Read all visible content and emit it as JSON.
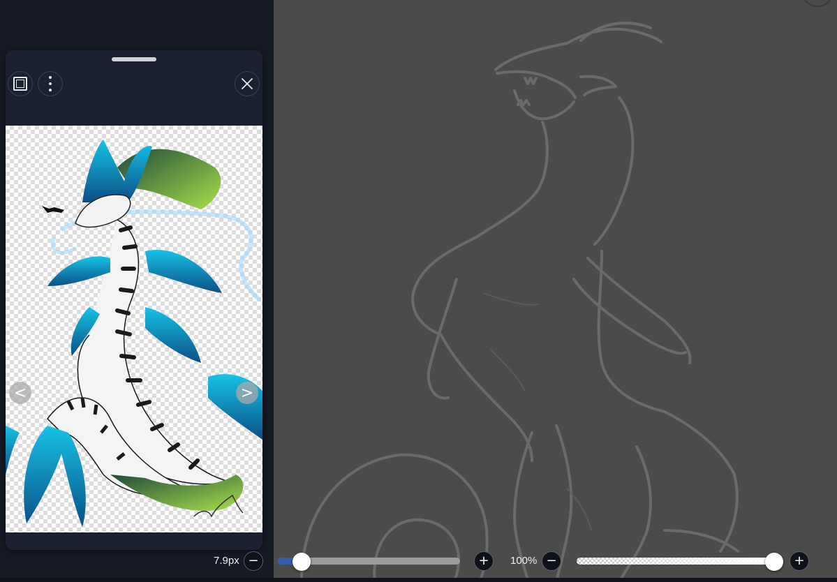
{
  "canvas": {
    "background": "#4b4b4b",
    "sketch_stroke": "#6e6e6e"
  },
  "reference_panel": {
    "frame_icon": "frame-icon",
    "more_icon": "more-vertical-icon",
    "close_icon": "close-icon",
    "prev_icon": "chevron-left-icon",
    "next_icon": "chevron-right-icon",
    "prev_glyph": "<",
    "next_glyph": ">",
    "image_description_colors": [
      "#0b7fb0",
      "#17c3e6",
      "#1f4b3b",
      "#a7e04a",
      "#1a1a1a"
    ]
  },
  "toolbar": {
    "brush_size_label": "7.9px",
    "brush_size_fraction": 0.13,
    "opacity_label": "100%",
    "opacity_fraction": 1.0,
    "minus_glyph": "−",
    "plus_glyph": "+",
    "accent": "#2f5fa8"
  }
}
